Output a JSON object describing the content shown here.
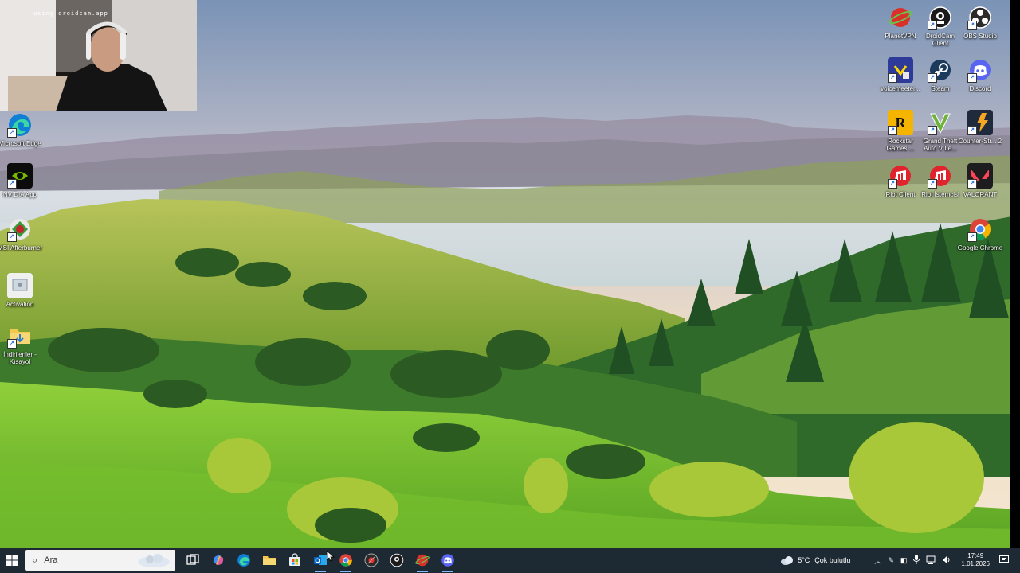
{
  "webcam": {
    "caption": "using droidcam.app"
  },
  "desktop_icons_left": [
    {
      "label": "Microsoft Edge",
      "icon": "edge-icon"
    },
    {
      "label": "NVIDIA App",
      "icon": "nvidia-icon"
    },
    {
      "label": "MSI Afterburner",
      "icon": "msi-afterburner-icon"
    },
    {
      "label": "Activation",
      "icon": "activation-icon"
    },
    {
      "label": "İndirilenler - Kısayol",
      "icon": "downloads-folder-icon"
    }
  ],
  "desktop_icons_right": [
    {
      "label": "PlanetVPN",
      "icon": "planetvpn-icon"
    },
    {
      "label": "DroidCam Client",
      "icon": "droidcam-icon"
    },
    {
      "label": "OBS Studio",
      "icon": "obs-icon"
    },
    {
      "label": "voicemeeter...",
      "icon": "voicemeeter-icon"
    },
    {
      "label": "Steam",
      "icon": "steam-icon"
    },
    {
      "label": "Discord",
      "icon": "discord-icon"
    },
    {
      "label": "Rockstar Games ...",
      "icon": "rockstar-icon"
    },
    {
      "label": "Grand Theft Auto V Le...",
      "icon": "gta-icon"
    },
    {
      "label": "Counter-Str... 2",
      "icon": "cs2-icon"
    },
    {
      "label": "Riot Client",
      "icon": "riot-client-icon"
    },
    {
      "label": "Riot İstemcisi",
      "icon": "riot-istemcisi-icon"
    },
    {
      "label": "VALORANT",
      "icon": "valorant-icon"
    },
    {
      "label": "Google Chrome",
      "icon": "chrome-icon"
    }
  ],
  "taskbar": {
    "search_placeholder": "Ara",
    "weather_temp": "5°C",
    "weather_text": "Çok bulutlu",
    "time": "17:49",
    "date": "1.01.2026"
  }
}
